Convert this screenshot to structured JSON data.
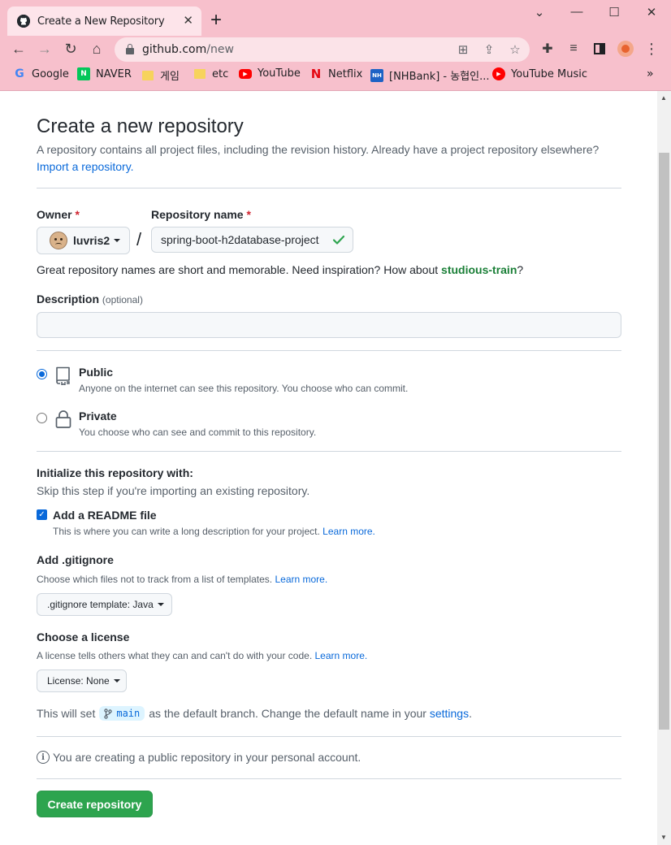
{
  "browser": {
    "tab_title": "Create a New Repository",
    "url_host": "github.com",
    "url_path": "/new",
    "bookmarks": [
      {
        "label": "Google",
        "icon": "google-icon"
      },
      {
        "label": "NAVER",
        "icon": "naver-icon"
      },
      {
        "label": "게임",
        "icon": "folder-icon"
      },
      {
        "label": "etc",
        "icon": "folder-icon"
      },
      {
        "label": "YouTube",
        "icon": "youtube-icon"
      },
      {
        "label": "Netflix",
        "icon": "netflix-icon"
      },
      {
        "label": "[NHBank] - 농협인...",
        "icon": "nhbank-icon"
      },
      {
        "label": "YouTube Music",
        "icon": "youtube-music-icon"
      }
    ],
    "chrome_color": "#f7c0cc"
  },
  "page": {
    "title": "Create a new repository",
    "subtitle": "A repository contains all project files, including the revision history. Already have a project repository elsewhere?",
    "import_link": "Import a repository.",
    "owner_label": "Owner",
    "repo_label": "Repository name",
    "required_mark": "*",
    "owner_value": "luvris2",
    "slash": "/",
    "repo_value": "spring-boot-h2database-project",
    "hint_prefix": "Great repository names are short and memorable. Need inspiration? How about",
    "hint_suggestion": "studious-train",
    "hint_suffix": "?",
    "description_label": "Description",
    "description_optional": "(optional)",
    "description_value": "",
    "visibility": [
      {
        "title": "Public",
        "desc": "Anyone on the internet can see this repository. You choose who can commit.",
        "selected": true
      },
      {
        "title": "Private",
        "desc": "You choose who can see and commit to this repository.",
        "selected": false
      }
    ],
    "init_title": "Initialize this repository with:",
    "init_sub": "Skip this step if you're importing an existing repository.",
    "readme_label": "Add a README file",
    "readme_checked": true,
    "readme_desc": "This is where you can write a long description for your project.",
    "learn_more": "Learn more.",
    "gitignore_title": "Add .gitignore",
    "gitignore_desc": "Choose which files not to track from a list of templates.",
    "gitignore_value": ".gitignore template: Java",
    "license_title": "Choose a license",
    "license_desc": "A license tells others what they can and can't do with your code.",
    "license_value": "License: None",
    "branch_prefix": "This will set",
    "branch_name": "main",
    "branch_middle": "as the default branch. Change the default name in your",
    "branch_link": "settings",
    "branch_suffix": ".",
    "info_text": "You are creating a public repository in your personal account.",
    "create_button": "Create repository",
    "accent_green": "#2da44e",
    "link_blue": "#0969da"
  }
}
